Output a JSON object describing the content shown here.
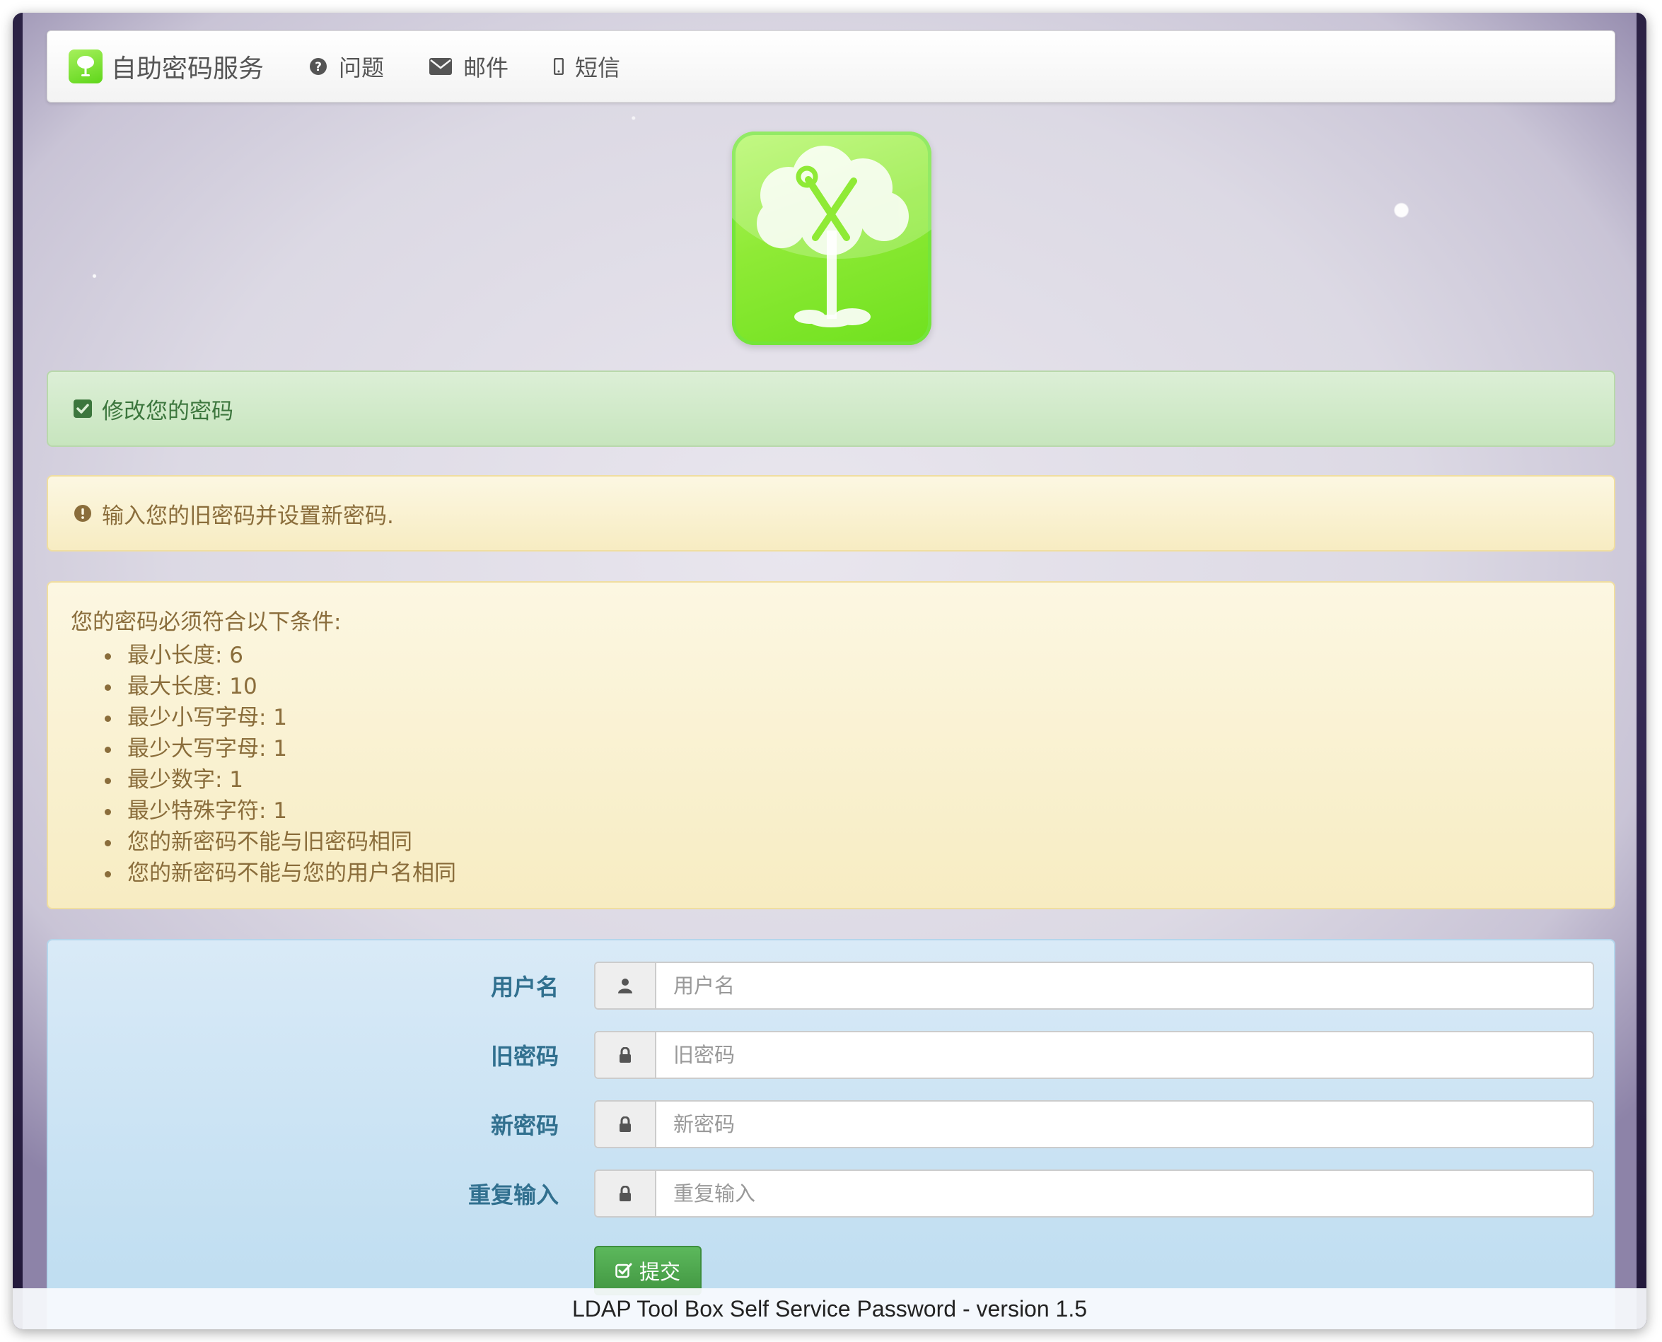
{
  "navbar": {
    "brand": "自助密码服务",
    "items": [
      {
        "label": "问题",
        "icon": "question-circle-icon"
      },
      {
        "label": "邮件",
        "icon": "envelope-icon"
      },
      {
        "label": "短信",
        "icon": "mobile-phone-icon"
      }
    ]
  },
  "logo": {
    "icon": "tree-wrench-logo"
  },
  "alerts": {
    "title": "修改您的密码",
    "instruction": "输入您的旧密码并设置新密码."
  },
  "policy": {
    "title": "您的密码必须符合以下条件:",
    "rules": [
      "最小长度: 6",
      "最大长度: 10",
      "最少小写字母: 1",
      "最少大写字母: 1",
      "最少数字: 1",
      "最少特殊字符: 1",
      "您的新密码不能与旧密码相同",
      "您的新密码不能与您的用户名相同"
    ]
  },
  "form": {
    "fields": [
      {
        "label": "用户名",
        "placeholder": "用户名",
        "value": "",
        "icon": "user-icon"
      },
      {
        "label": "旧密码",
        "placeholder": "旧密码",
        "value": "",
        "icon": "lock-icon"
      },
      {
        "label": "新密码",
        "placeholder": "新密码",
        "value": "",
        "icon": "lock-icon"
      },
      {
        "label": "重复输入",
        "placeholder": "重复输入",
        "value": "",
        "icon": "lock-icon"
      }
    ],
    "submit": "提交"
  },
  "footer": {
    "text": "LDAP Tool Box Self Service Password - version 1.5"
  },
  "colors": {
    "success_text": "#3c763d",
    "warning_text": "#8a6d3b",
    "info_label": "#31708f",
    "button_green": "#5cb85c",
    "logo_green": "#8fea36"
  }
}
